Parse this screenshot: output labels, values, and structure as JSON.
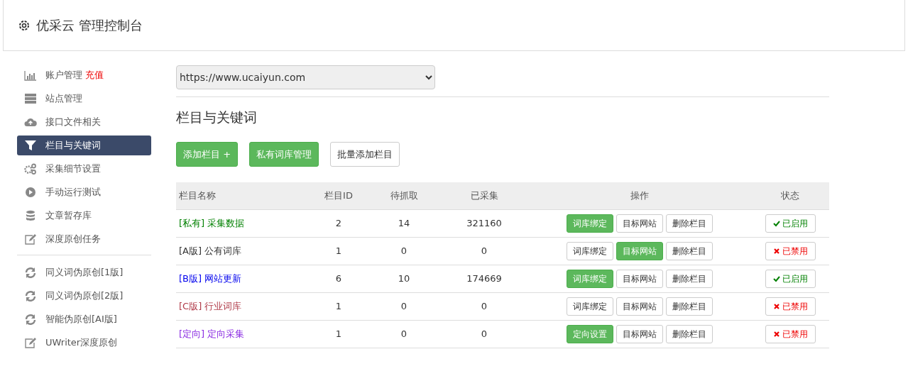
{
  "header": {
    "title": "优采云 管理控制台"
  },
  "sidebar": {
    "groups": [
      {
        "items": [
          {
            "kind": "bar-chart",
            "label": "账户管理",
            "extra": "充值",
            "selected": false
          },
          {
            "kind": "server",
            "label": "站点管理",
            "selected": false
          },
          {
            "kind": "cloud-upload",
            "label": "接口文件相关",
            "selected": false
          },
          {
            "kind": "filter",
            "label": "栏目与关键词",
            "selected": true
          },
          {
            "kind": "gears",
            "label": "采集细节设置",
            "selected": false
          },
          {
            "kind": "play",
            "label": "手动运行测试",
            "selected": false
          },
          {
            "kind": "database",
            "label": "文章暂存库",
            "selected": false
          },
          {
            "kind": "edit",
            "label": "深度原创任务",
            "selected": false
          }
        ]
      },
      {
        "items": [
          {
            "kind": "refresh",
            "label": "同义词伪原创[1版]",
            "selected": false
          },
          {
            "kind": "refresh",
            "label": "同义词伪原创[2版]",
            "selected": false
          },
          {
            "kind": "refresh",
            "label": "智能伪原创[AI版]",
            "selected": false
          },
          {
            "kind": "edit",
            "label": "UWriter深度原创",
            "selected": false
          }
        ]
      }
    ]
  },
  "site_select": {
    "value": "https://www.ucaiyun.com"
  },
  "section_title": "栏目与关键词",
  "actions": [
    {
      "label": "添加栏目 +",
      "kind": "success"
    },
    {
      "label": "私有词库管理",
      "kind": "success"
    },
    {
      "label": "批量添加栏目",
      "kind": "default"
    }
  ],
  "table": {
    "columns": [
      "栏目名称",
      "栏目ID",
      "待抓取",
      "已采集",
      "操作",
      "状态"
    ],
    "rows": [
      {
        "name": "[私有] 采集数据",
        "color": "#008000",
        "id": "2",
        "pending": "14",
        "collected": "321160",
        "ops": [
          {
            "label": "词库绑定",
            "highlighted": true
          },
          {
            "label": "目标网站",
            "highlighted": false
          },
          {
            "label": "删除栏目",
            "highlighted": false
          }
        ],
        "status": {
          "enabled": true,
          "label": "已启用"
        }
      },
      {
        "name": "[A版] 公有词库",
        "color": "#333333",
        "id": "1",
        "pending": "0",
        "collected": "0",
        "ops": [
          {
            "label": "词库绑定",
            "highlighted": false
          },
          {
            "label": "目标网站",
            "highlighted": true
          },
          {
            "label": "删除栏目",
            "highlighted": false
          }
        ],
        "status": {
          "enabled": false,
          "label": "已禁用"
        }
      },
      {
        "name": "[B版] 网站更新",
        "color": "#0000ee",
        "id": "6",
        "pending": "10",
        "collected": "174669",
        "ops": [
          {
            "label": "词库绑定",
            "highlighted": true
          },
          {
            "label": "目标网站",
            "highlighted": false
          },
          {
            "label": "删除栏目",
            "highlighted": false
          }
        ],
        "status": {
          "enabled": true,
          "label": "已启用"
        }
      },
      {
        "name": "[C版] 行业词库",
        "color": "#b03a48",
        "id": "1",
        "pending": "0",
        "collected": "0",
        "ops": [
          {
            "label": "词库绑定",
            "highlighted": false
          },
          {
            "label": "目标网站",
            "highlighted": false
          },
          {
            "label": "删除栏目",
            "highlighted": false
          }
        ],
        "status": {
          "enabled": false,
          "label": "已禁用"
        }
      },
      {
        "name": "[定向] 定向采集",
        "color": "#8a2be2",
        "id": "1",
        "pending": "0",
        "collected": "0",
        "ops": [
          {
            "label": "定向设置",
            "highlighted": true
          },
          {
            "label": "目标网站",
            "highlighted": false
          },
          {
            "label": "删除栏目",
            "highlighted": false
          }
        ],
        "status": {
          "enabled": false,
          "label": "已禁用"
        }
      }
    ]
  }
}
